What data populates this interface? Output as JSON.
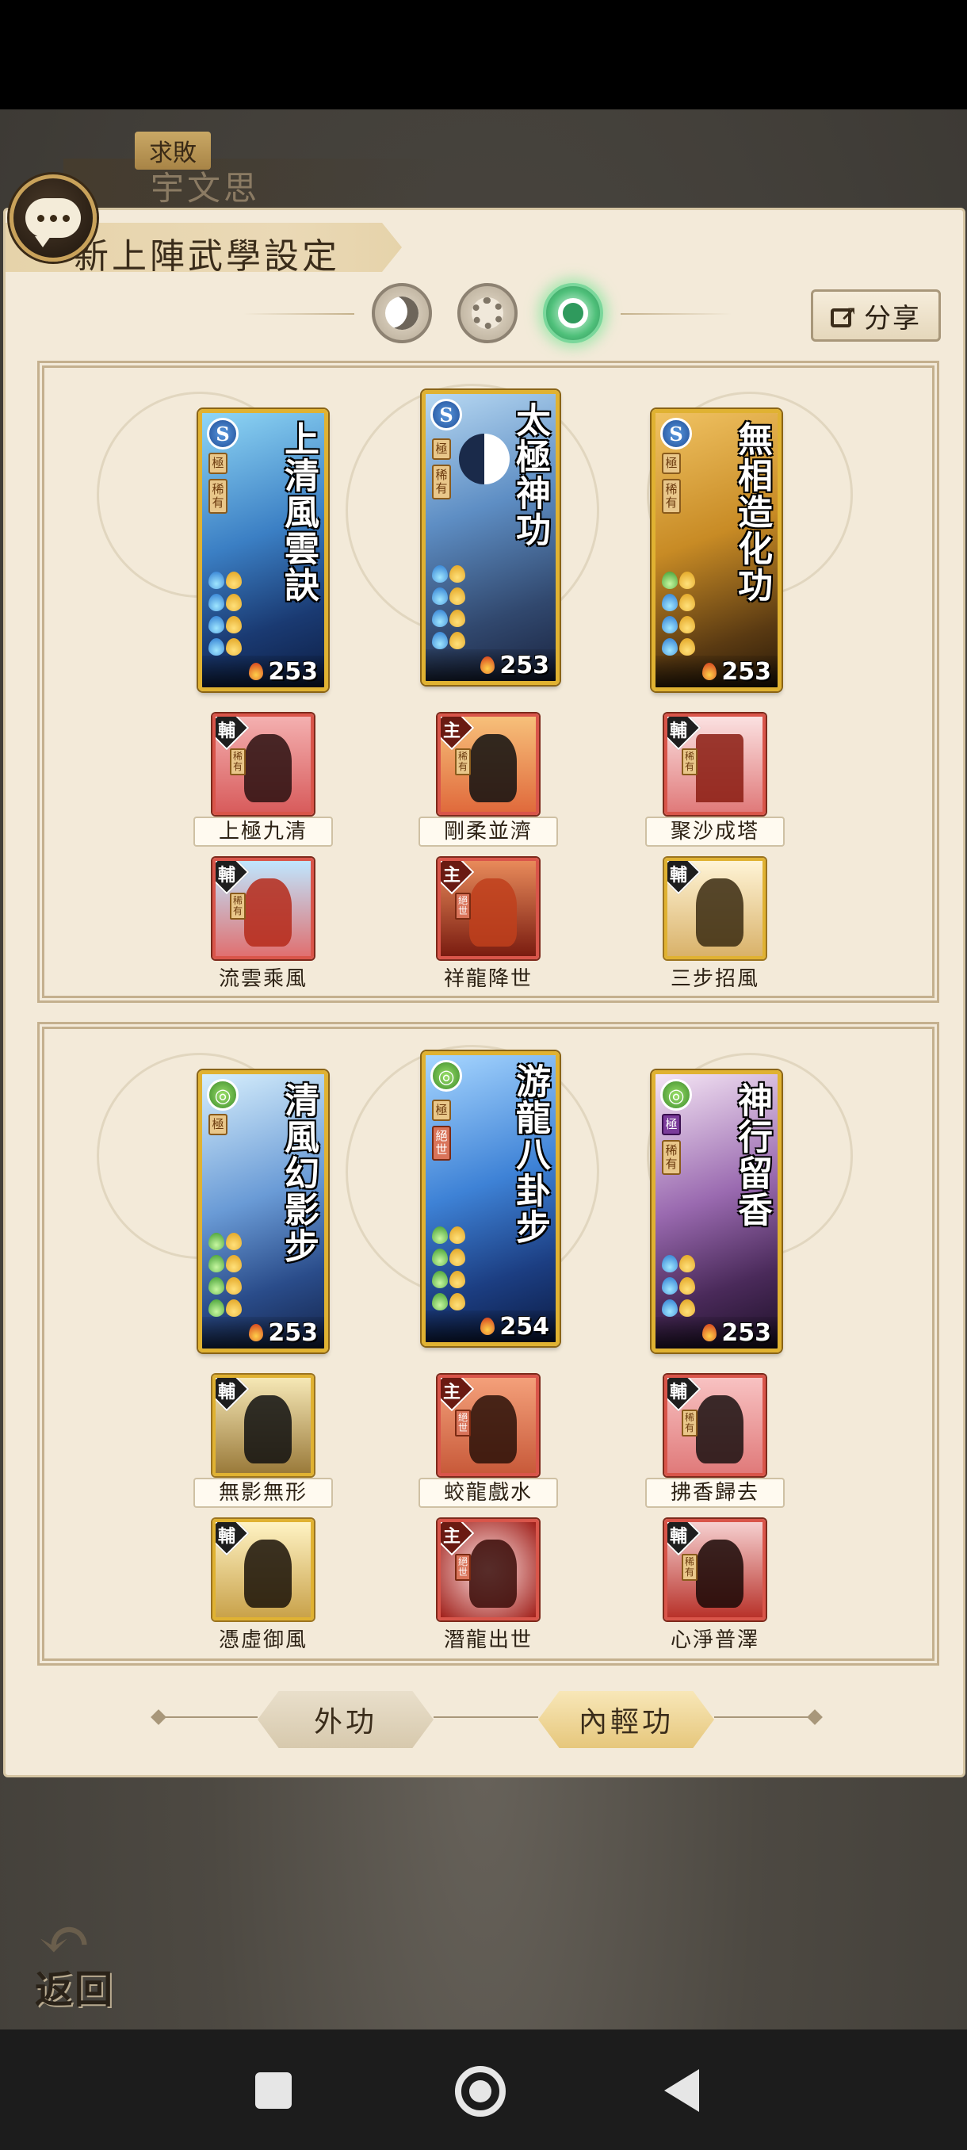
{
  "header": {
    "character_title": "求敗",
    "character_name": "宇文思",
    "panel_title": "新上陣武學設定"
  },
  "toolbar": {
    "share_label": "分享"
  },
  "outer_section": {
    "cards": [
      {
        "name": "上清風雲訣",
        "power": "253",
        "badge": "S",
        "rank": "極",
        "rarity": "稀有"
      },
      {
        "name": "太極神功",
        "power": "253",
        "badge": "S",
        "rank": "極",
        "rarity": "稀有"
      },
      {
        "name": "無相造化功",
        "power": "253",
        "badge": "S",
        "rank": "極",
        "rarity": "稀有"
      }
    ],
    "sub_row_1": [
      {
        "role": "輔",
        "rarity": "稀有",
        "name": "上極九清"
      },
      {
        "role": "主",
        "rarity": "稀有",
        "name": "剛柔並濟"
      },
      {
        "role": "輔",
        "rarity": "稀有",
        "name": "聚沙成塔"
      }
    ],
    "sub_row_2": [
      {
        "role": "輔",
        "rarity": "稀有",
        "name": "流雲乘風"
      },
      {
        "role": "主",
        "rarity": "絕世",
        "name": "祥龍降世"
      },
      {
        "role": "輔",
        "rarity": "",
        "name": "三步招風"
      }
    ]
  },
  "inner_section": {
    "cards": [
      {
        "name": "清風幻影步",
        "power": "253",
        "rank": "極",
        "rarity": ""
      },
      {
        "name": "游龍八卦步",
        "power": "254",
        "rank": "極",
        "rarity": "絕世"
      },
      {
        "name": "神行留香",
        "power": "253",
        "rank": "極",
        "rarity": "稀有"
      }
    ],
    "sub_row_1": [
      {
        "role": "輔",
        "rarity": "",
        "name": "無影無形"
      },
      {
        "role": "主",
        "rarity": "絕世",
        "name": "蛟龍戲水"
      },
      {
        "role": "輔",
        "rarity": "稀有",
        "name": "拂香歸去"
      }
    ],
    "sub_row_2": [
      {
        "role": "輔",
        "rarity": "",
        "name": "憑虛御風"
      },
      {
        "role": "主",
        "rarity": "絕世",
        "name": "潛龍出世"
      },
      {
        "role": "輔",
        "rarity": "稀有",
        "name": "心淨普澤"
      }
    ]
  },
  "bottom_tabs": {
    "outer_label": "外功",
    "inner_label": "內輕功"
  },
  "back": {
    "label": "返回"
  }
}
